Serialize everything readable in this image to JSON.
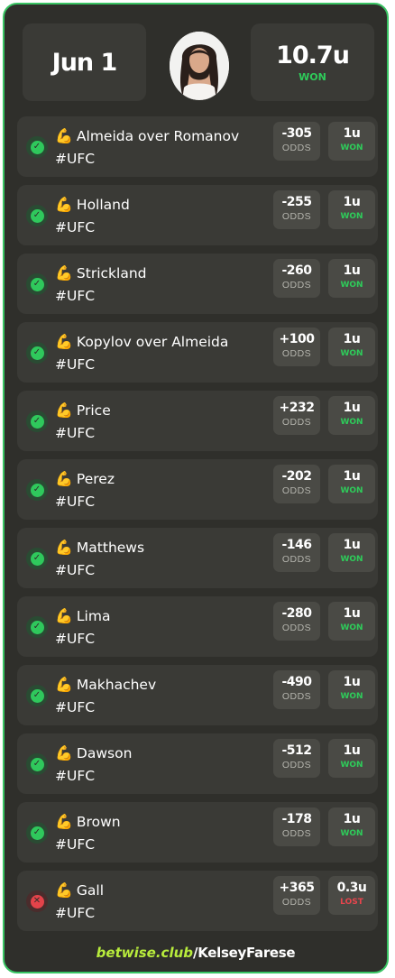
{
  "header": {
    "date": "Jun 1",
    "total_units": "10.7u",
    "total_status": "WON"
  },
  "odds_label": "ODDS",
  "colors": {
    "accent_green": "#2ecc5a",
    "lost_red": "#e8454d",
    "brand_lime": "#b8ec3c",
    "card_bg": "#2f2f2b",
    "border": "#39c463"
  },
  "bets": [
    {
      "status": "won",
      "icon": "check-circle-icon",
      "emoji": "💪",
      "pick": "Almeida over Romanov",
      "tag": "#UFC",
      "odds": "-305",
      "units": "1u",
      "result": "WON"
    },
    {
      "status": "won",
      "icon": "check-circle-icon",
      "emoji": "💪",
      "pick": "Holland",
      "tag": "#UFC",
      "odds": "-255",
      "units": "1u",
      "result": "WON"
    },
    {
      "status": "won",
      "icon": "check-circle-icon",
      "emoji": "💪",
      "pick": "Strickland",
      "tag": "#UFC",
      "odds": "-260",
      "units": "1u",
      "result": "WON"
    },
    {
      "status": "won",
      "icon": "check-circle-icon",
      "emoji": "💪",
      "pick": "Kopylov over Almeida",
      "tag": "#UFC",
      "odds": "+100",
      "units": "1u",
      "result": "WON"
    },
    {
      "status": "won",
      "icon": "check-circle-icon",
      "emoji": "💪",
      "pick": "Price",
      "tag": "#UFC",
      "odds": "+232",
      "units": "1u",
      "result": "WON"
    },
    {
      "status": "won",
      "icon": "check-circle-icon",
      "emoji": "💪",
      "pick": "Perez",
      "tag": "#UFC",
      "odds": "-202",
      "units": "1u",
      "result": "WON"
    },
    {
      "status": "won",
      "icon": "check-circle-icon",
      "emoji": "💪",
      "pick": "Matthews",
      "tag": "#UFC",
      "odds": "-146",
      "units": "1u",
      "result": "WON"
    },
    {
      "status": "won",
      "icon": "check-circle-icon",
      "emoji": "💪",
      "pick": "Lima",
      "tag": "#UFC",
      "odds": "-280",
      "units": "1u",
      "result": "WON"
    },
    {
      "status": "won",
      "icon": "check-circle-icon",
      "emoji": "💪",
      "pick": "Makhachev",
      "tag": "#UFC",
      "odds": "-490",
      "units": "1u",
      "result": "WON"
    },
    {
      "status": "won",
      "icon": "check-circle-icon",
      "emoji": "💪",
      "pick": "Dawson",
      "tag": "#UFC",
      "odds": "-512",
      "units": "1u",
      "result": "WON"
    },
    {
      "status": "won",
      "icon": "check-circle-icon",
      "emoji": "💪",
      "pick": "Brown",
      "tag": "#UFC",
      "odds": "-178",
      "units": "1u",
      "result": "WON"
    },
    {
      "status": "lost",
      "icon": "x-circle-icon",
      "emoji": "💪",
      "pick": "Gall",
      "tag": "#UFC",
      "odds": "+365",
      "units": "0.3u",
      "result": "LOST"
    }
  ],
  "footer": {
    "brand": "betwise.club",
    "handle": "/KelseyFarese"
  }
}
